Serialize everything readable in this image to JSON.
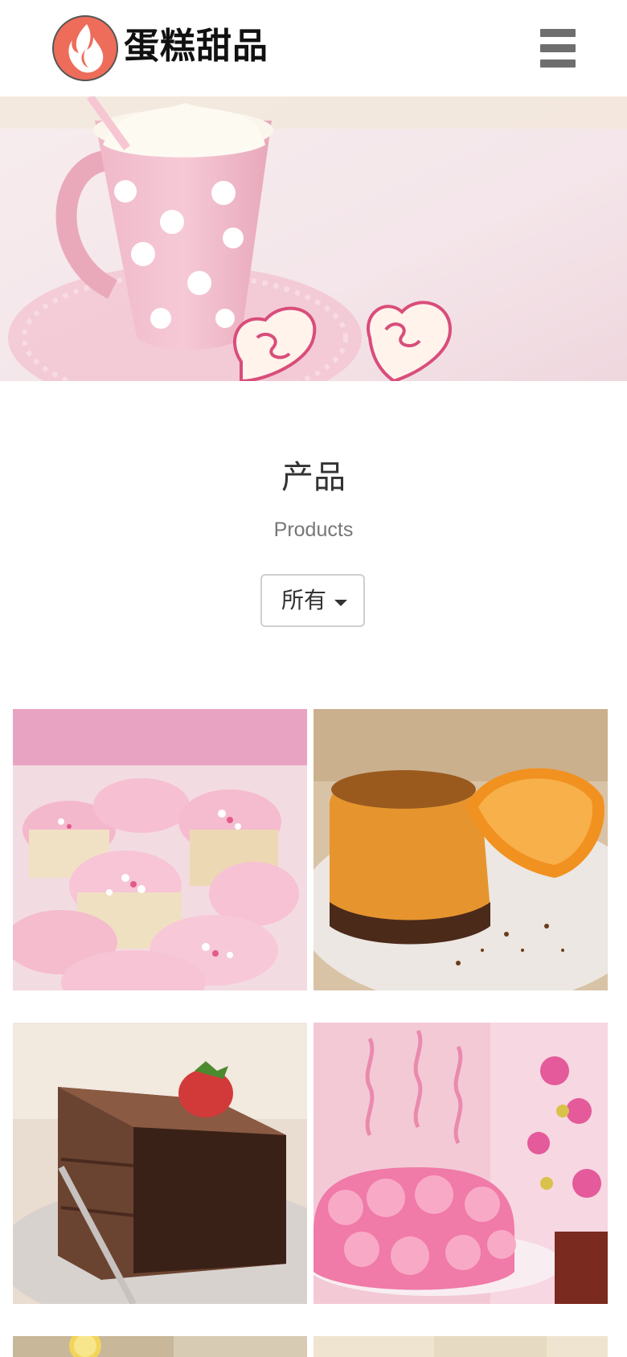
{
  "header": {
    "brand_name": "蛋糕甜品",
    "logo_icon": "flame-logo-icon",
    "menu_icon": "hamburger-menu-icon",
    "accent": "#ee6c5a"
  },
  "banner": {
    "image": "pink-polka-dot-mug-with-whipped-cream-and-heart-cookies"
  },
  "products": {
    "title": "产品",
    "subtitle": "Products",
    "filter": {
      "selected": "所有",
      "icon": "caret-down-icon"
    },
    "items": [
      {
        "image": "pink-frosted-cupcakes"
      },
      {
        "image": "orange-sponge-cake-with-orange-slice"
      },
      {
        "image": "chocolate-cake-slice-with-strawberry"
      },
      {
        "image": "pink-rose-cake-with-candles"
      },
      {
        "image": "lemon-tart"
      },
      {
        "image": "dessert-with-label"
      }
    ]
  }
}
